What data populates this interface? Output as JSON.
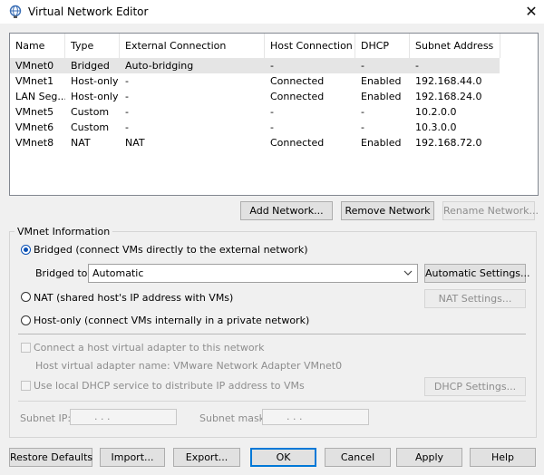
{
  "window": {
    "title": "Virtual Network Editor",
    "close_glyph": "✕",
    "icon": "vmware-network-icon"
  },
  "table": {
    "columns": [
      "Name",
      "Type",
      "External Connection",
      "Host Connection",
      "DHCP",
      "Subnet Address"
    ],
    "rows": [
      {
        "name": "VMnet0",
        "type": "Bridged",
        "external": "Auto-bridging",
        "host": "-",
        "dhcp": "-",
        "subnet": "-",
        "selected": true
      },
      {
        "name": "VMnet1",
        "type": "Host-only",
        "external": "-",
        "host": "Connected",
        "dhcp": "Enabled",
        "subnet": "192.168.44.0"
      },
      {
        "name": "LAN Seg...",
        "type": "Host-only",
        "external": "-",
        "host": "Connected",
        "dhcp": "Enabled",
        "subnet": "192.168.24.0"
      },
      {
        "name": "VMnet5",
        "type": "Custom",
        "external": "-",
        "host": "-",
        "dhcp": "-",
        "subnet": "10.2.0.0"
      },
      {
        "name": "VMnet6",
        "type": "Custom",
        "external": "-",
        "host": "-",
        "dhcp": "-",
        "subnet": "10.3.0.0"
      },
      {
        "name": "VMnet8",
        "type": "NAT",
        "external": "NAT",
        "host": "Connected",
        "dhcp": "Enabled",
        "subnet": "192.168.72.0"
      }
    ]
  },
  "table_buttons": {
    "add": "Add Network...",
    "remove": "Remove Network",
    "rename": "Rename Network..."
  },
  "vmnet_info": {
    "group_label": "VMnet Information",
    "bridged_label": "Bridged (connect VMs directly to the external network)",
    "bridged_to_label": "Bridged to:",
    "bridged_to_value": "Automatic",
    "auto_settings": "Automatic Settings...",
    "nat_label": "NAT (shared host's IP address with VMs)",
    "nat_settings": "NAT Settings...",
    "hostonly_label": "Host-only (connect VMs internally in a private network)",
    "connect_adapter_label": "Connect a host virtual adapter to this network",
    "adapter_name_label": "Host virtual adapter name: VMware Network Adapter VMnet0",
    "dhcp_label": "Use local DHCP service to distribute IP address to VMs",
    "dhcp_settings": "DHCP Settings...",
    "subnet_ip_label": "Subnet IP:",
    "subnet_mask_label": "Subnet mask:",
    "ip_dots": ". . .",
    "mode": "bridged"
  },
  "footer": {
    "restore": "Restore Defaults",
    "import": "Import...",
    "export": "Export...",
    "ok": "OK",
    "cancel": "Cancel",
    "apply": "Apply",
    "help": "Help"
  },
  "colors": {
    "accent": "#0078d7",
    "radio": "#0a50b4",
    "selected_row": "#e5e5e5",
    "disabled_text": "#8d8d8d"
  }
}
